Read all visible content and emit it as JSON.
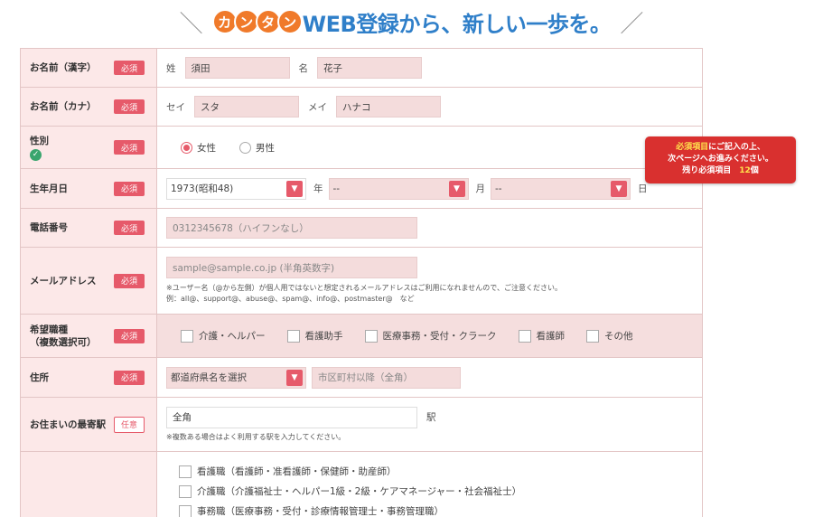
{
  "header": {
    "slash_left": "＼",
    "pill_chars": [
      "カ",
      "ン",
      "タ",
      "ン"
    ],
    "headline": "WEB登録から、新しい一歩を。",
    "slash_right": "／"
  },
  "badges": {
    "required": "必須",
    "optional": "任意"
  },
  "name_kanji": {
    "label": "お名前（漢字）",
    "sei_label": "姓",
    "sei_value": "須田",
    "mei_label": "名",
    "mei_value": "花子"
  },
  "name_kana": {
    "label": "お名前（カナ）",
    "sei_label": "セイ",
    "sei_value": "スタ",
    "mei_label": "メイ",
    "mei_value": "ハナコ"
  },
  "gender": {
    "label": "性別",
    "options": [
      {
        "label": "女性",
        "selected": true
      },
      {
        "label": "男性",
        "selected": false
      }
    ]
  },
  "birthday": {
    "label": "生年月日",
    "year_value": "1973(昭和48)",
    "year_unit": "年",
    "month_value": "--",
    "month_unit": "月",
    "day_value": "--",
    "day_unit": "日"
  },
  "phone": {
    "label": "電話番号",
    "placeholder": "0312345678（ハイフンなし）"
  },
  "email": {
    "label": "メールアドレス",
    "placeholder": "sample@sample.co.jp (半角英数字)",
    "note1": "※ユーザー名（@から左側）が個人用ではないと想定されるメールアドレスはご利用になれませんので、ご注意ください。",
    "note2": "例：all@、support@、abuse@、spam@、info@、postmaster@　など"
  },
  "jobs": {
    "label_line1": "希望職種",
    "label_line2": "（複数選択可）",
    "options": [
      "介護・ヘルパー",
      "看護助手",
      "医療事務・受付・クラーク",
      "看護師",
      "その他"
    ]
  },
  "address": {
    "label": "住所",
    "pref_value": "都道府県名を選択",
    "city_placeholder": "市区町村以降（全角）"
  },
  "station": {
    "label": "お住まいの最寄駅",
    "value": "全角",
    "suffix": "駅",
    "note": "※複数ある場合はよく利用する駅を入力してください。"
  },
  "qualifications": {
    "options": [
      "看護職（看護師・准看護師・保健師・助産師）",
      "介護職（介護福祉士・ヘルパー1級・2級・ケアマネージャー・社会福祉士）",
      "事務職（医療事務・受付・診療情報管理士・事務管理職）"
    ]
  },
  "notice": {
    "line1_highlight": "必須項目",
    "line1_rest": "にご記入の上、",
    "line2": "次ページへお進みください。",
    "line3_prefix": "残り必須項目　",
    "count": "12",
    "count_unit": "個"
  },
  "colors": {
    "accent": "#e65a6a",
    "headline": "#2f7fc9",
    "pill": "#f07a2a",
    "notice": "#d9302f",
    "label_bg": "#fce8e8"
  }
}
